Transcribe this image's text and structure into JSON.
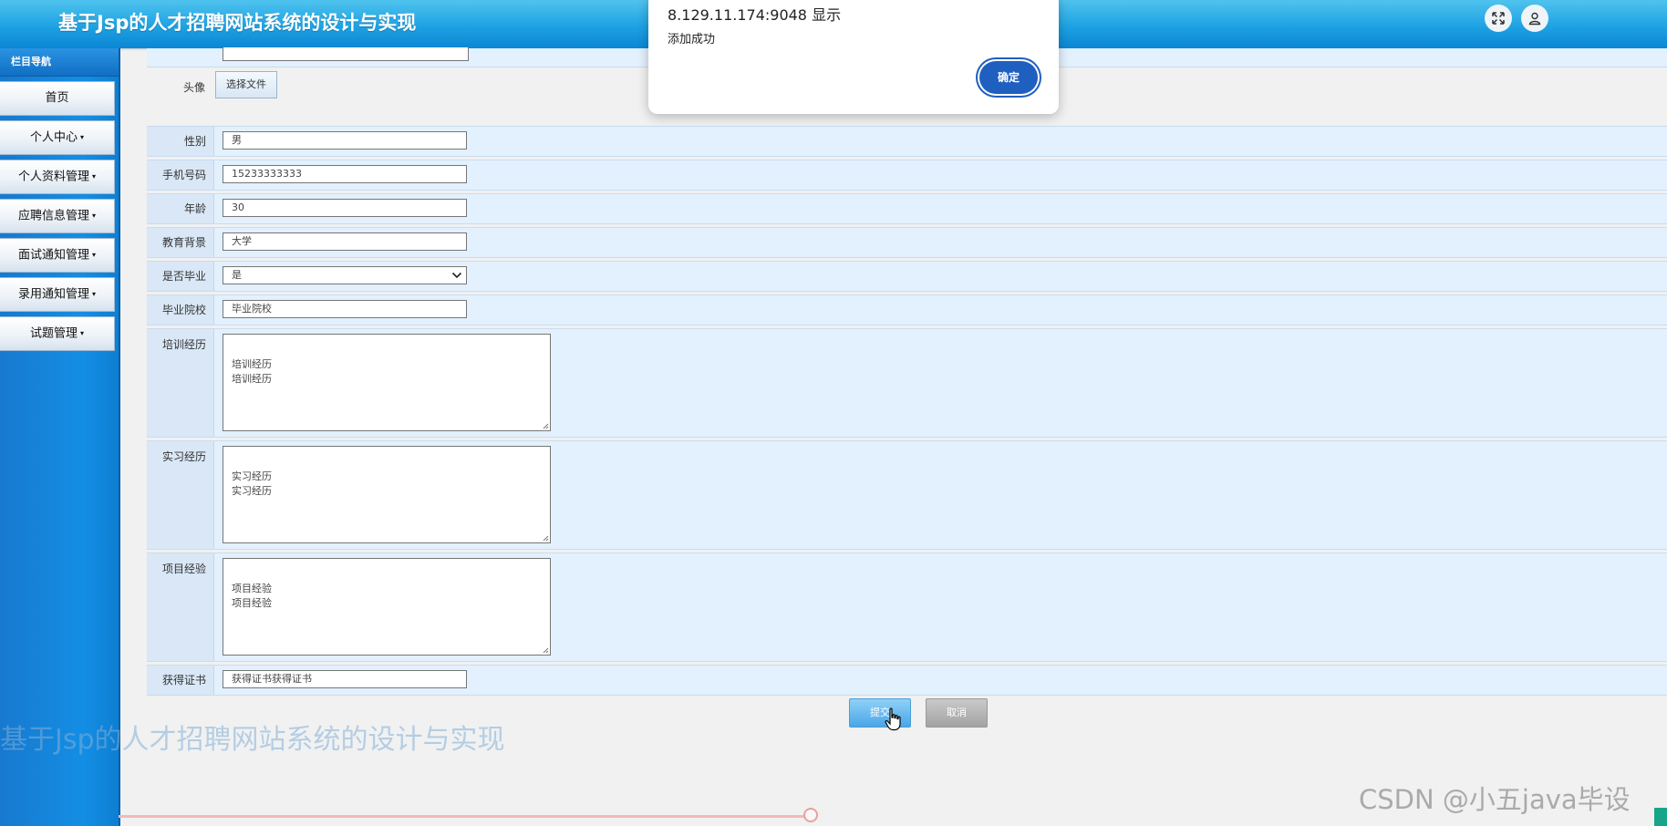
{
  "header": {
    "site_title": "基于Jsp的人才招聘网站系统的设计与实现",
    "fullscreen_icon": "expand-icon",
    "user_icon": "user-icon"
  },
  "sidebar": {
    "heading": "栏目导航",
    "items": [
      {
        "label": "首页",
        "has_caret": false
      },
      {
        "label": "个人中心",
        "has_caret": true
      },
      {
        "label": "个人资料管理",
        "has_caret": true
      },
      {
        "label": "应聘信息管理",
        "has_caret": true
      },
      {
        "label": "面试通知管理",
        "has_caret": true
      },
      {
        "label": "录用通知管理",
        "has_caret": true
      },
      {
        "label": "试题管理",
        "has_caret": true
      }
    ],
    "caret_glyph": "▾"
  },
  "form": {
    "avatar_label": "头像",
    "file_button": "选择文件",
    "gender": {
      "label": "性别",
      "value": "男"
    },
    "phone": {
      "label": "手机号码",
      "value": "15233333333"
    },
    "age": {
      "label": "年龄",
      "value": "30"
    },
    "education": {
      "label": "教育背景",
      "value": "大学"
    },
    "graduated": {
      "label": "是否毕业",
      "value": "是"
    },
    "school": {
      "label": "毕业院校",
      "value": "毕业院校"
    },
    "training": {
      "label": "培训经历",
      "value": "培训经历\n培训经历"
    },
    "internship": {
      "label": "实习经历",
      "value": "实习经历\n实习经历"
    },
    "project": {
      "label": "项目经验",
      "value": "项目经验\n项目经验"
    },
    "certificate": {
      "label": "获得证书",
      "value": "获得证书获得证书"
    },
    "submit_label": "提交",
    "cancel_label": "取消"
  },
  "dialog": {
    "title": "8.129.11.174:9048 显示",
    "message": "添加成功",
    "ok_label": "确定"
  },
  "watermarks": {
    "sidebar_overlay": "基于Jsp的人才招聘网站系统的设计与实现",
    "csdn": "CSDN @小五java毕设"
  },
  "colors": {
    "header_blue": "#1ea2e3",
    "sidebar_blue": "#138ee4",
    "row_bg": "#e3f0fd",
    "dialog_button": "#1f5fbf",
    "submit_blue": "#4aa6e6",
    "cancel_gray": "#a3a3a3"
  }
}
